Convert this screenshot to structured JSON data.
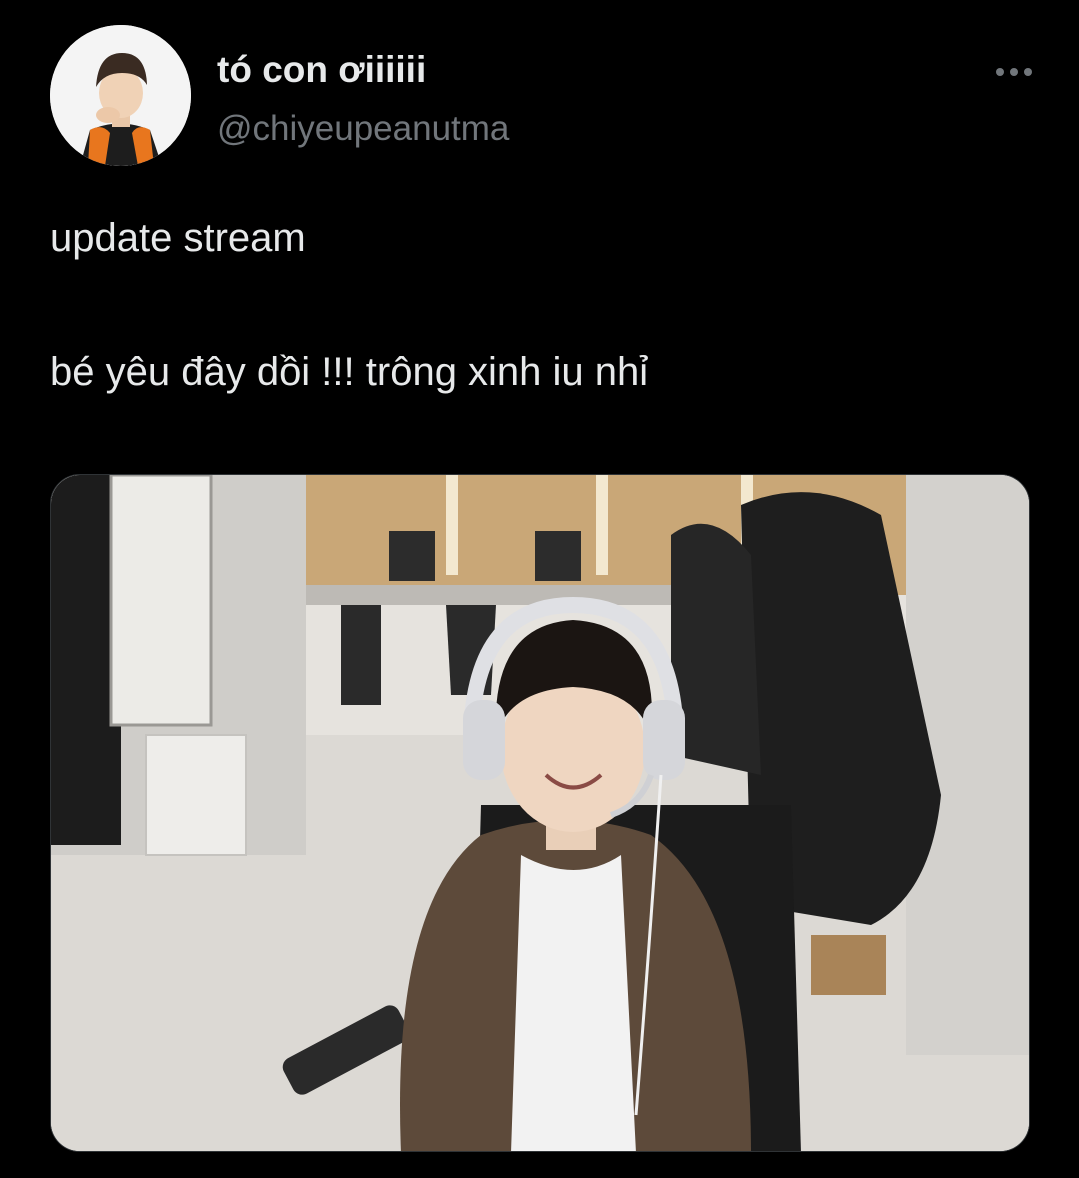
{
  "tweet": {
    "author": {
      "display_name": "tó con ơiiiiii",
      "handle": "@chiyeupeanutma"
    },
    "text_lines": [
      "update stream",
      "bé yêu đây dồi !!! trông xinh iu nhỉ"
    ],
    "more_icon": "more-horizontal-icon",
    "media": {
      "kind": "photo"
    }
  },
  "colors": {
    "background": "#000000",
    "primary_text": "#e7e9ea",
    "secondary_text": "#71767b"
  }
}
